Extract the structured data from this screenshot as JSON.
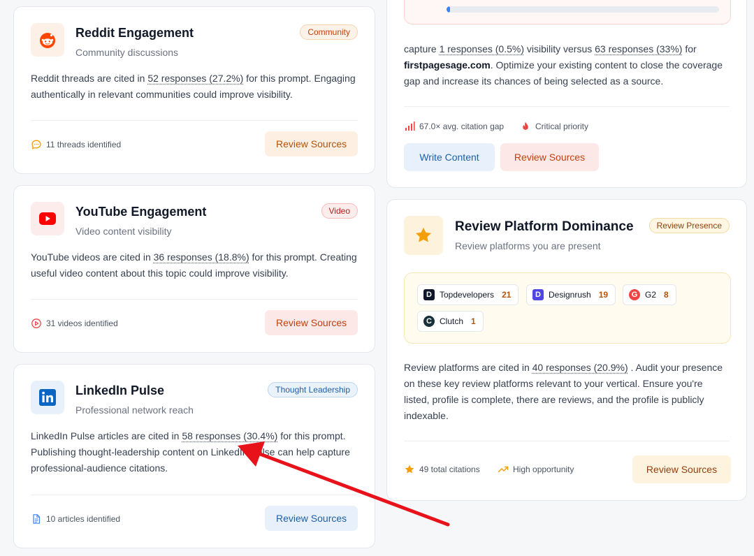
{
  "reddit": {
    "icon": "reddit-icon",
    "title": "Reddit Engagement",
    "subtitle": "Community discussions",
    "badge": "Community",
    "desc_pre": "Reddit threads are cited in ",
    "desc_link": "52 responses (27.2%)",
    "desc_post": " for this prompt. Engaging authentically in relevant communities could improve visibility.",
    "footer": "11 threads identified",
    "button": "Review Sources"
  },
  "youtube": {
    "icon": "youtube-icon",
    "title": "YouTube Engagement",
    "subtitle": "Video content visibility",
    "badge": "Video",
    "desc_pre": "YouTube videos are cited in ",
    "desc_link": "36 responses (18.8%)",
    "desc_post": " for this prompt. Creating useful video content about this topic could improve visibility.",
    "footer": "31 videos identified",
    "button": "Review Sources"
  },
  "linkedin": {
    "icon": "linkedin-icon",
    "title": "LinkedIn Pulse",
    "subtitle": "Professional network reach",
    "badge": "Thought Leadership",
    "desc_pre": "LinkedIn Pulse articles are cited in ",
    "desc_link": "58 responses (30.4%)",
    "desc_post": " for this prompt. Publishing thought-leadership content on LinkedIn Pulse can help capture professional-audience citations.",
    "footer": "10 articles identified",
    "button": "Review Sources"
  },
  "gap_card": {
    "progress_fraction": 0.005,
    "desc_pre": "capture ",
    "desc_link1": "1 responses (0.5%)",
    "desc_mid": " visibility versus ",
    "desc_link2": "63 responses (33%)",
    "desc_mid2": " for ",
    "desc_domain": "firstpagesage.com",
    "desc_post": ". Optimize your existing content to close the coverage gap and increase its chances of being selected as a source.",
    "stat_gap": "67.0× avg. citation gap",
    "stat_priority": "Critical priority",
    "button_write": "Write Content",
    "button_review": "Review Sources"
  },
  "review_card": {
    "icon": "star-icon",
    "title": "Review Platform Dominance",
    "subtitle": "Review platforms you are present",
    "badge": "Review Presence",
    "platforms": [
      {
        "name": "Topdevelopers",
        "count": "21",
        "logo": "D"
      },
      {
        "name": "Designrush",
        "count": "19",
        "logo": "D"
      },
      {
        "name": "G2",
        "count": "8",
        "logo": "G"
      },
      {
        "name": "Clutch",
        "count": "1",
        "logo": "C"
      }
    ],
    "desc_pre": "Review platforms are cited in ",
    "desc_link": "40 responses (20.9%)",
    "desc_post": " . Audit your presence on these key review platforms relevant to your vertical. Ensure you're listed, profile is complete, there are reviews, and the profile is publicly indexable.",
    "stat_citations": "49 total citations",
    "stat_opportunity": "High opportunity",
    "button": "Review Sources"
  },
  "colors": {
    "reddit": "#ff4500",
    "youtube": "#ff0000",
    "linkedin": "#0a66c2",
    "star": "#f59e0b",
    "annotation_arrow": "#e8121b"
  }
}
